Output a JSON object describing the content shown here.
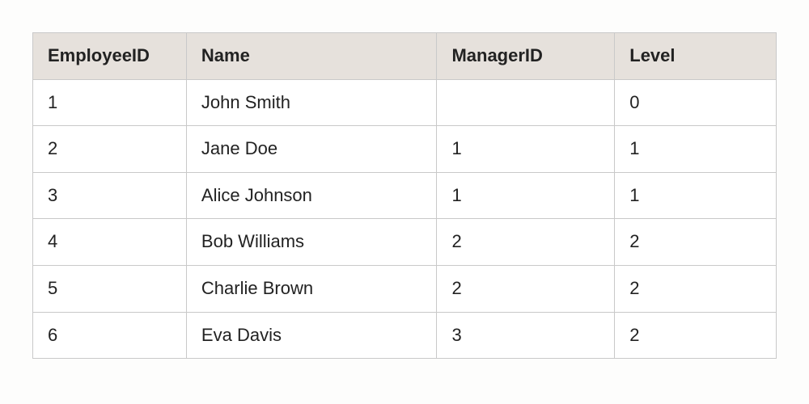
{
  "table": {
    "headers": {
      "employee_id": "EmployeeID",
      "name": "Name",
      "manager_id": "ManagerID",
      "level": "Level"
    },
    "rows": [
      {
        "employee_id": "1",
        "name": "John Smith",
        "manager_id": "",
        "level": "0"
      },
      {
        "employee_id": "2",
        "name": "Jane Doe",
        "manager_id": "1",
        "level": "1"
      },
      {
        "employee_id": "3",
        "name": "Alice Johnson",
        "manager_id": "1",
        "level": "1"
      },
      {
        "employee_id": "4",
        "name": "Bob Williams",
        "manager_id": "2",
        "level": "2"
      },
      {
        "employee_id": "5",
        "name": "Charlie Brown",
        "manager_id": "2",
        "level": "2"
      },
      {
        "employee_id": "6",
        "name": "Eva Davis",
        "manager_id": "3",
        "level": "2"
      }
    ]
  }
}
